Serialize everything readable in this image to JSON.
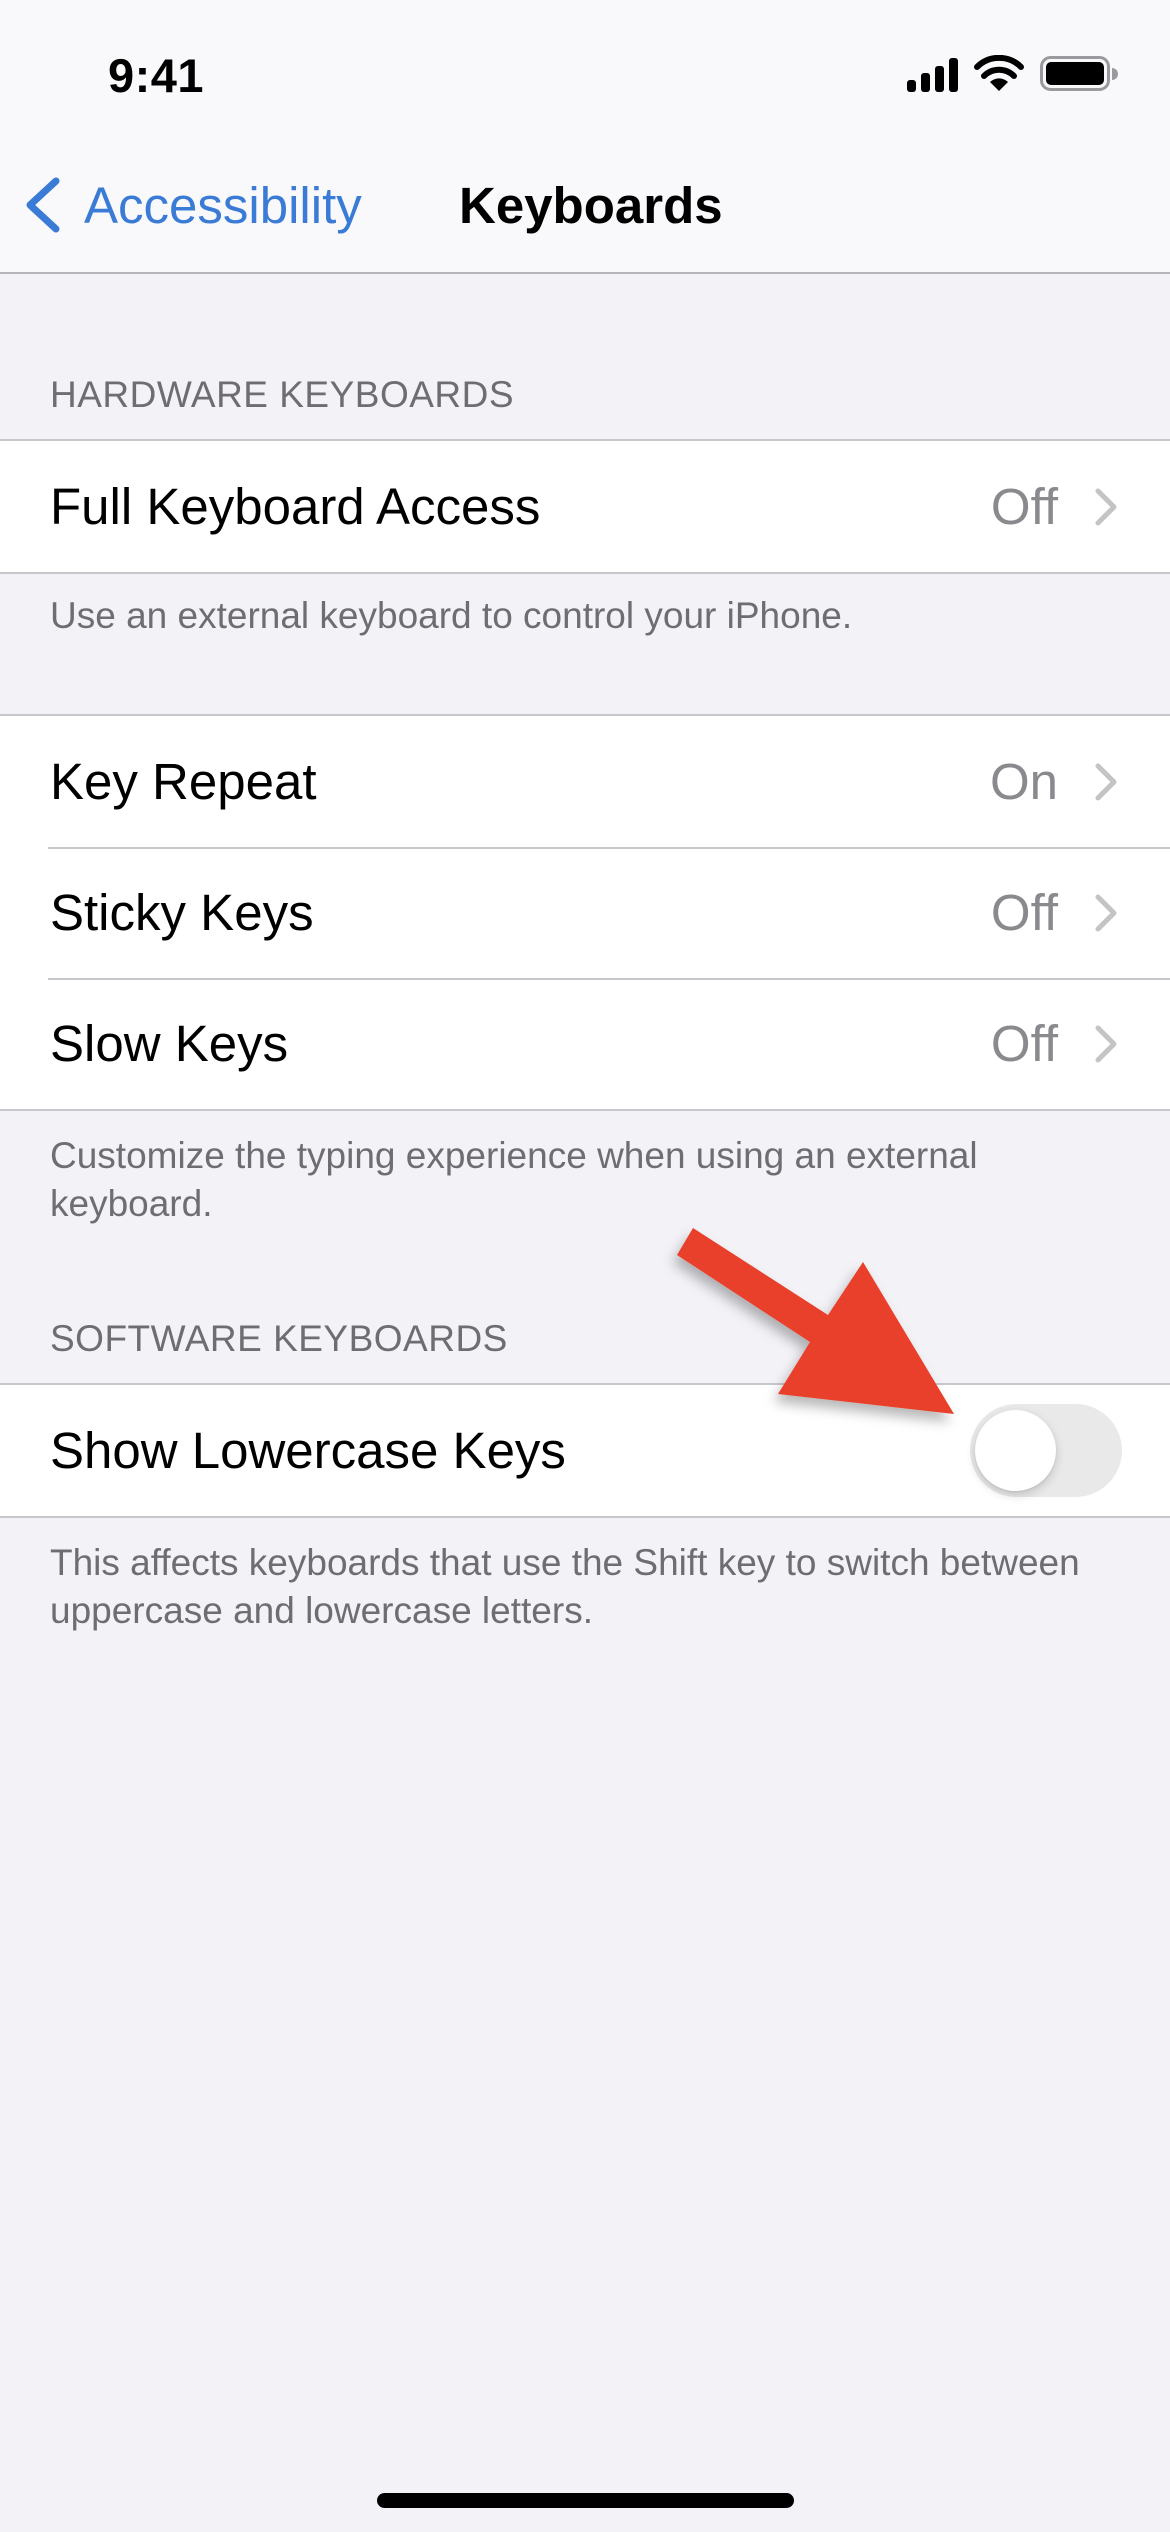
{
  "status_bar": {
    "time": "9:41",
    "icons": [
      "cellular-signal-icon",
      "wifi-icon",
      "battery-icon"
    ]
  },
  "nav": {
    "back_label": "Accessibility",
    "back_icon": "chevron-left-icon",
    "title": "Keyboards"
  },
  "sections": {
    "hardware": {
      "header": "HARDWARE KEYBOARDS",
      "rows": [
        {
          "label": "Full Keyboard Access",
          "value": "Off"
        }
      ],
      "footer": "Use an external keyboard to control your iPhone."
    },
    "hardware_options": {
      "rows": [
        {
          "label": "Key Repeat",
          "value": "On"
        },
        {
          "label": "Sticky Keys",
          "value": "Off"
        },
        {
          "label": "Slow Keys",
          "value": "Off"
        }
      ],
      "footer": "Customize the typing experience when using an external keyboard."
    },
    "software": {
      "header": "SOFTWARE KEYBOARDS",
      "rows": [
        {
          "label": "Show Lowercase Keys",
          "toggle_on": false
        }
      ],
      "footer": "This affects keyboards that use the Shift key to switch between uppercase and lowercase letters."
    }
  },
  "colors": {
    "accent": "#3a7bd5",
    "annotation_arrow": "#e8402a",
    "toggle_off_track": "#e9e9ea",
    "background": "#f2f2f7"
  }
}
